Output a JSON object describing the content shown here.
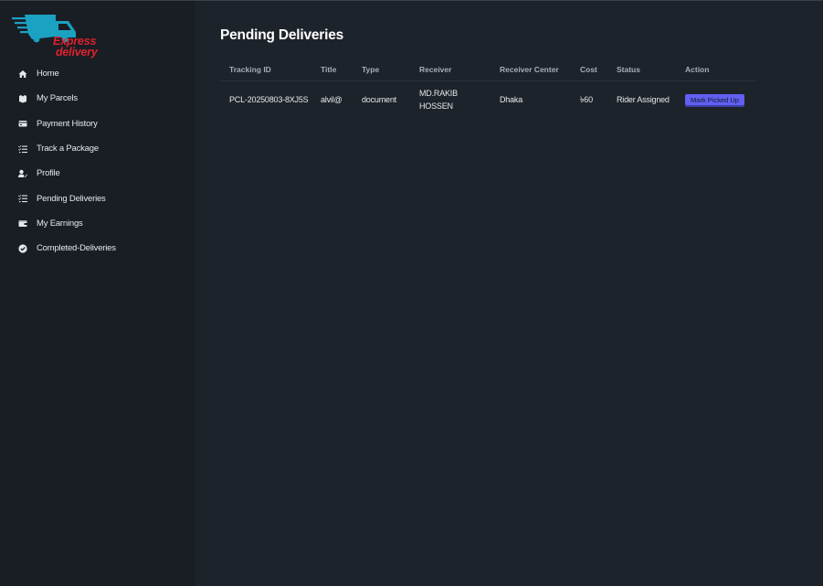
{
  "logo": {
    "line1": "Express",
    "line2": "delivery"
  },
  "nav": [
    {
      "label": "Home",
      "icon": "home-icon"
    },
    {
      "label": "My Parcels",
      "icon": "parcel-icon"
    },
    {
      "label": "Payment History",
      "icon": "payment-icon"
    },
    {
      "label": "Track a Package",
      "icon": "checklist-icon"
    },
    {
      "label": "Profile",
      "icon": "user-edit-icon"
    },
    {
      "label": "Pending Deliveries",
      "icon": "checklist-icon"
    },
    {
      "label": "My Earnings",
      "icon": "wallet-icon"
    },
    {
      "label": "Completed-Deliveries",
      "icon": "check-circle-icon"
    }
  ],
  "page": {
    "title": "Pending Deliveries"
  },
  "table": {
    "headers": [
      "Tracking ID",
      "Title",
      "Type",
      "Receiver",
      "Receiver Center",
      "Cost",
      "Status",
      "Action"
    ],
    "rows": [
      {
        "tracking_id": "PCL-20250803-8XJ5S",
        "title": "alvil@",
        "type": "document",
        "receiver": "MD.RAKIB HOSSEN",
        "receiver_center": "Dhaka",
        "cost": "৳60",
        "status": "Rider Assigned",
        "action": "Mark Picked Up"
      }
    ]
  },
  "colors": {
    "accent": "#6160f2",
    "brand": "#e0202e",
    "sidebar_bg": "#191e24",
    "main_bg": "#1d232a"
  }
}
